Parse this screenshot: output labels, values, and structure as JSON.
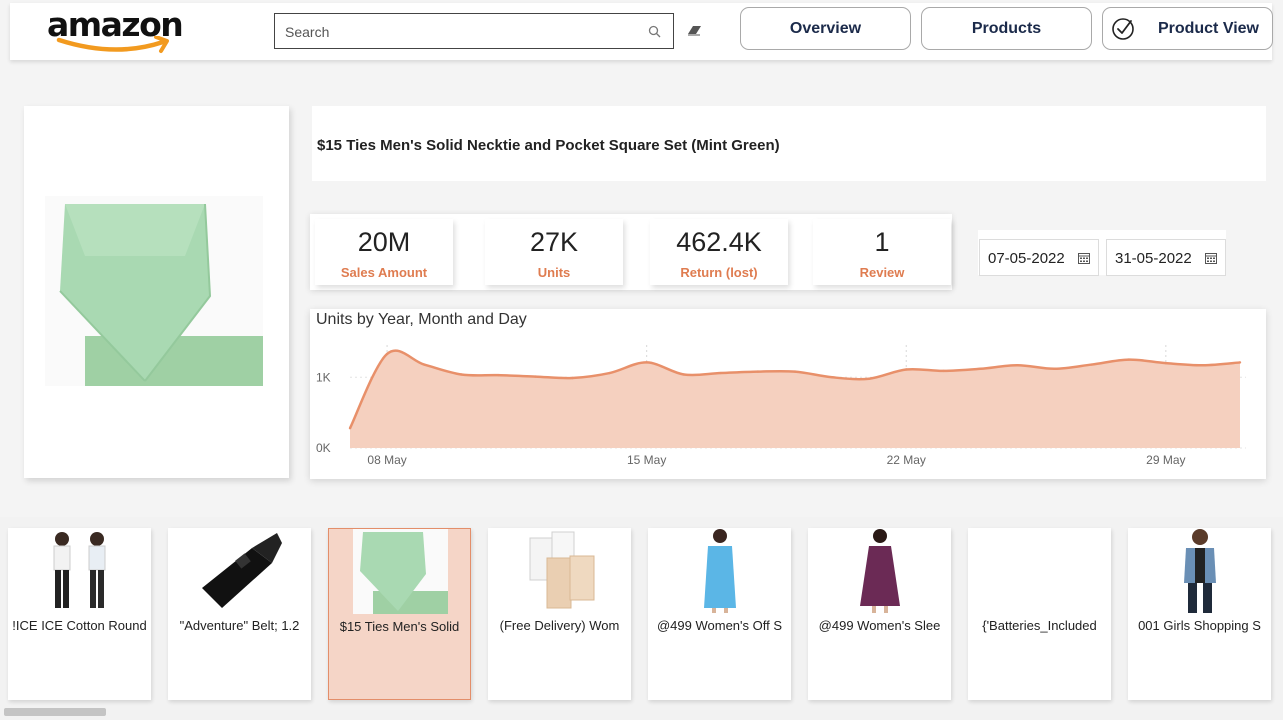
{
  "header": {
    "logo": "amazon",
    "search": {
      "placeholder": "Search"
    },
    "nav": [
      {
        "label": "Overview"
      },
      {
        "label": "Products"
      },
      {
        "label": "Product View"
      }
    ]
  },
  "product": {
    "title": "$15 Ties Men's Solid Necktie and Pocket Square Set (Mint Green)"
  },
  "kpis": [
    {
      "value": "20M",
      "label": "Sales Amount"
    },
    {
      "value": "27K",
      "label": "Units"
    },
    {
      "value": "462.4K",
      "label": "Return (lost)"
    },
    {
      "value": "1",
      "label": "Review"
    }
  ],
  "date_range": {
    "start": "07-05-2022",
    "end": "31-05-2022"
  },
  "chart_data": {
    "type": "area",
    "title": "Units by Year, Month and Day",
    "xlabel": "",
    "ylabel": "",
    "x": [
      "2022-05-07",
      "2022-05-08",
      "2022-05-09",
      "2022-05-10",
      "2022-05-11",
      "2022-05-12",
      "2022-05-13",
      "2022-05-14",
      "2022-05-15",
      "2022-05-16",
      "2022-05-17",
      "2022-05-18",
      "2022-05-19",
      "2022-05-20",
      "2022-05-21",
      "2022-05-22",
      "2022-05-23",
      "2022-05-24",
      "2022-05-25",
      "2022-05-26",
      "2022-05-27",
      "2022-05-28",
      "2022-05-29",
      "2022-05-30",
      "2022-05-31"
    ],
    "values": [
      280,
      1330,
      1180,
      1040,
      1030,
      1010,
      990,
      1060,
      1210,
      1040,
      1060,
      1080,
      1080,
      1000,
      980,
      1110,
      1090,
      1120,
      1170,
      1120,
      1180,
      1250,
      1200,
      1170,
      1210
    ],
    "x_ticks": [
      "08 May",
      "15 May",
      "22 May",
      "29 May"
    ],
    "y_ticks": [
      "0K",
      "1K"
    ],
    "ylim": [
      0,
      1400
    ],
    "grid": true,
    "color": "#e8906a",
    "fill": "#f5d0bf"
  },
  "products": [
    {
      "label": "!ICE ICE Cotton Round"
    },
    {
      "label": "\"Adventure\" Belt; 1.2"
    },
    {
      "label": "$15 Ties Men's Solid"
    },
    {
      "label": "(Free Delivery) Wom"
    },
    {
      "label": "@499 Women's Off S"
    },
    {
      "label": "@499 Women's Slee"
    },
    {
      "label": "{'Batteries_Included"
    },
    {
      "label": "001 Girls Shopping S"
    }
  ],
  "colors": {
    "accent": "#df7c50",
    "nav_text": "#1b2a4a",
    "tie": "#a8d8b0"
  }
}
